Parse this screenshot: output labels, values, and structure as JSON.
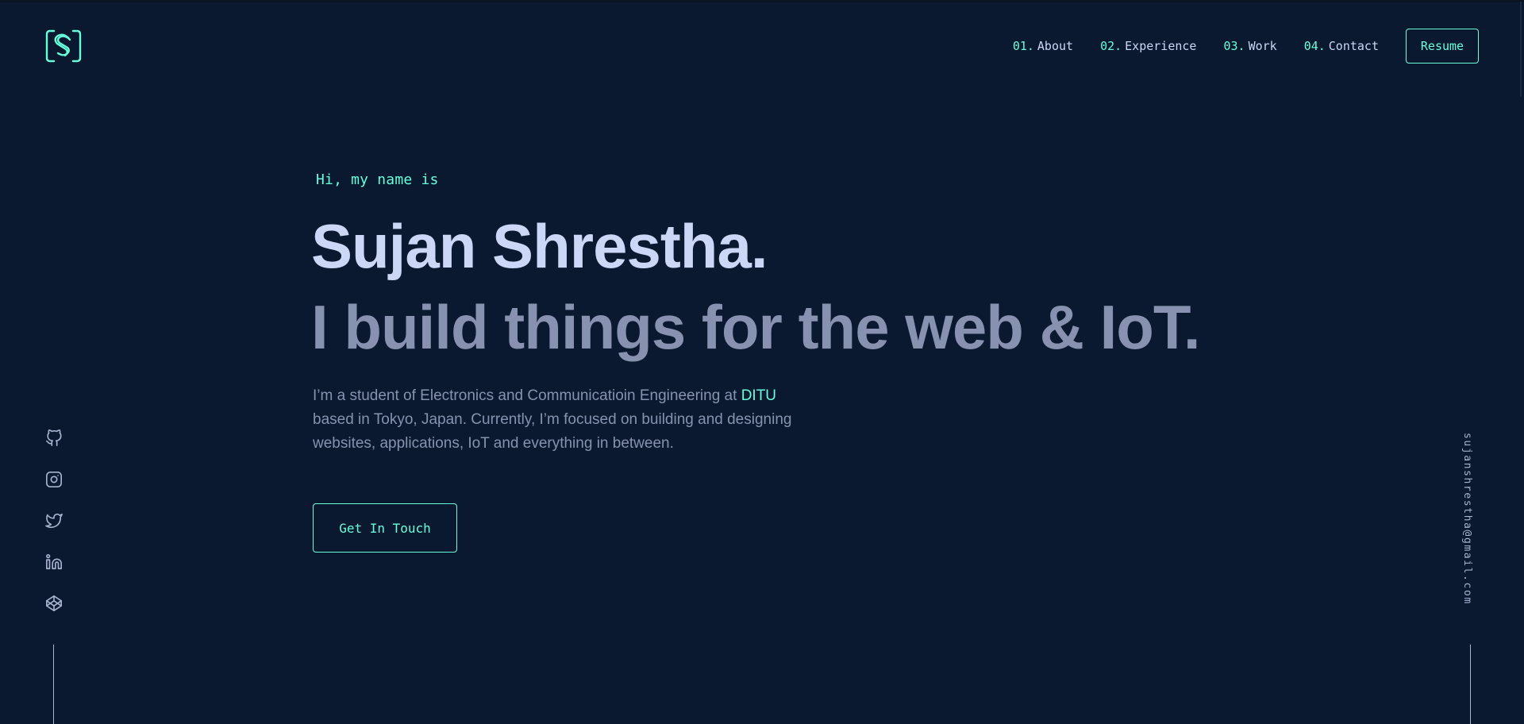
{
  "header": {
    "logo_icon": "bracket-s-logo",
    "nav": [
      {
        "num": "01.",
        "label": "About"
      },
      {
        "num": "02.",
        "label": "Experience"
      },
      {
        "num": "03.",
        "label": "Work"
      },
      {
        "num": "04.",
        "label": "Contact"
      }
    ],
    "resume_label": "Resume"
  },
  "hero": {
    "greeting": "Hi, my name is",
    "name": "Sujan Shrestha.",
    "tagline": "I build things for the web & IoT.",
    "bio_before": "I’m a student of Electronics and Communicatioin Engineering at ",
    "bio_highlight": "DITU",
    "bio_after": " based in Tokyo, Japan. Currently, I’m focused on building and designing websites, applications, IoT and everything in between.",
    "cta_label": "Get In Touch"
  },
  "social": [
    {
      "name": "github-icon"
    },
    {
      "name": "instagram-icon"
    },
    {
      "name": "twitter-icon"
    },
    {
      "name": "linkedin-icon"
    },
    {
      "name": "codepen-icon"
    }
  ],
  "email": "sujanshrestha@gmail.com",
  "colors": {
    "background": "#0a192f",
    "accent": "#64ffda",
    "heading": "#ccd6f6",
    "text": "#8892b0"
  }
}
